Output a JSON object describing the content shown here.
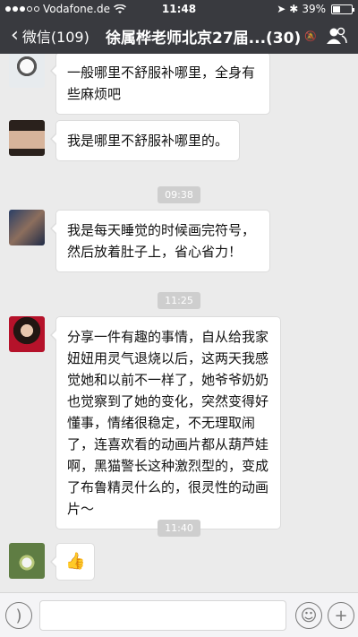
{
  "status": {
    "carrier": "Vodafone.de",
    "time": "11:48",
    "battery": "39%"
  },
  "nav": {
    "back_label": "微信(109)",
    "title": "徐属桦老师北京27届...(30)"
  },
  "messages": [
    {
      "text": "一般哪里不舒服补哪里，全身有些麻烦吧"
    },
    {
      "text": "我是哪里不舒服补哪里的。"
    },
    {
      "text": "我是每天睡觉的时候画完符号，然后放着肚子上，省心省力！"
    },
    {
      "text": "分享一件有趣的事情，自从给我家妞妞用灵气退烧以后，这两天我感觉她和以前不一样了，她爷爷奶奶也觉察到了她的变化，突然变得好懂事，情绪很稳定，不无理取闹了，连喜欢看的动画片都从葫芦娃啊，黑猫警长这种激烈型的，变成了布鲁精灵什么的，很灵性的动画片～"
    },
    {
      "text": "👍"
    }
  ],
  "timestamps": [
    "09:38",
    "11:25",
    "11:40"
  ]
}
